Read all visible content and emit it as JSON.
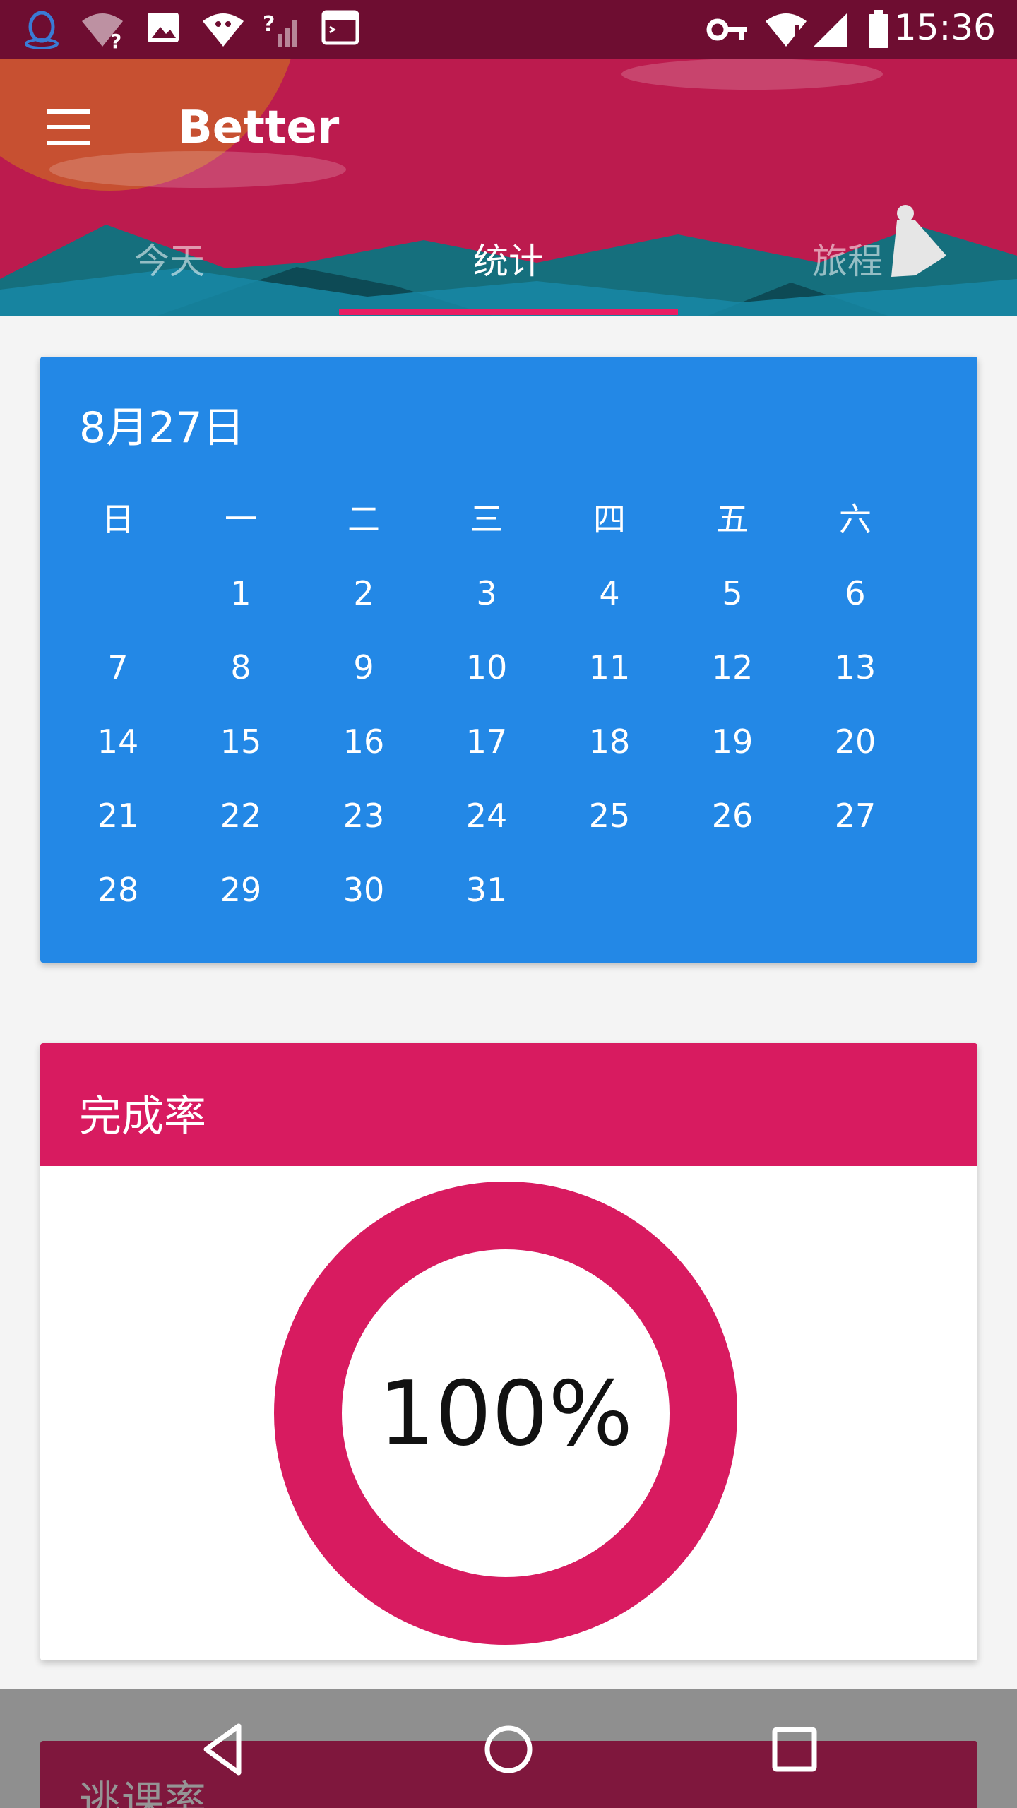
{
  "status_bar": {
    "time": "15:36",
    "icons": [
      "qq-icon",
      "wifi-unknown-icon",
      "image-icon",
      "android-icon",
      "signal-unknown-icon",
      "terminal-icon",
      "vpn-key-icon",
      "wifi-alert-icon",
      "signal-icon",
      "battery-icon"
    ]
  },
  "header": {
    "app_title": "Better",
    "menu_icon": "hamburger-menu-icon",
    "tabs": [
      {
        "label": "今天",
        "active": false
      },
      {
        "label": "统计",
        "active": true
      },
      {
        "label": "旅程",
        "active": false
      }
    ],
    "colors": {
      "primary": "#bc1b4e",
      "status": "#6e0d31",
      "indicator": "#e91e63"
    }
  },
  "calendar": {
    "date_label": "8月27日",
    "weekdays": [
      "日",
      "一",
      "二",
      "三",
      "四",
      "五",
      "六"
    ],
    "first_weekday_index": 1,
    "days_in_month": 31,
    "color": "#2388e6"
  },
  "completion": {
    "title": "完成率",
    "value_label": "100%",
    "rate": 1.0,
    "color": "#d81b60"
  },
  "skip_card": {
    "title": "逃课率"
  },
  "nav_bar": {
    "buttons": [
      "back-icon",
      "home-icon",
      "recents-icon"
    ]
  }
}
